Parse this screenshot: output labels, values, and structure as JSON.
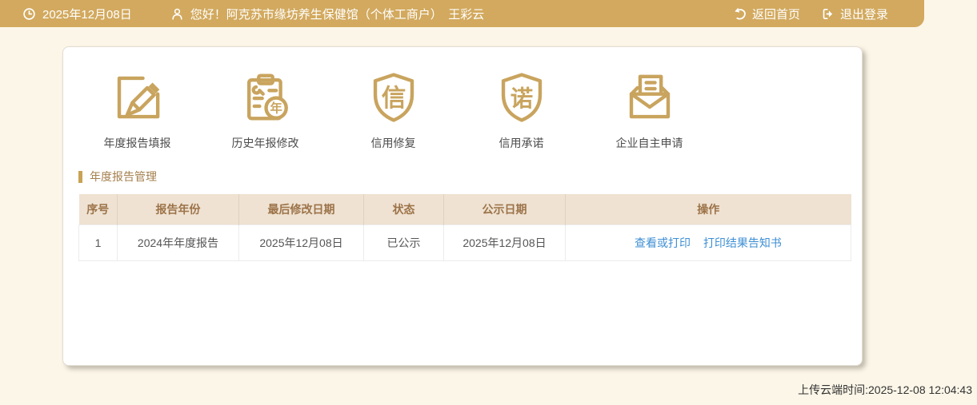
{
  "topbar": {
    "date": "2025年12月08日",
    "greeting": "您好！阿克苏市缘坊养生保健馆（个体工商户）　王彩云",
    "home_label": "返回首页",
    "logout_label": "退出登录"
  },
  "shortcuts": [
    {
      "label": "年度报告填报",
      "icon": "edit-report-icon"
    },
    {
      "label": "历史年报修改",
      "icon": "history-report-icon",
      "char": "年"
    },
    {
      "label": "信用修复",
      "icon": "credit-repair-shield-icon",
      "char": "信"
    },
    {
      "label": "信用承诺",
      "icon": "credit-promise-shield-icon",
      "char": "诺"
    },
    {
      "label": "企业自主申请",
      "icon": "self-apply-mail-icon"
    }
  ],
  "section": {
    "title": "年度报告管理"
  },
  "table": {
    "headers": [
      "序号",
      "报告年份",
      "最后修改日期",
      "状态",
      "公示日期",
      "操作"
    ],
    "rows": [
      {
        "index": "1",
        "report_year": "2024年年度报告",
        "last_modified": "2025年12月08日",
        "status": "已公示",
        "publish_date": "2025年12月08日",
        "action_view": "查看或打印",
        "action_notice": "打印结果告知书"
      }
    ]
  },
  "footer": {
    "upload_time": "上传云端时间:2025-12-08 12:04:43"
  },
  "colors": {
    "topbar_gold": "#D2A95E",
    "icon_gold": "#C9A45E",
    "page_cream": "#FCF6E8",
    "table_header_bg": "#EFE2D2",
    "table_header_text": "#9C7349",
    "link_blue": "#3E8FD4",
    "section_title": "#A5804E"
  }
}
